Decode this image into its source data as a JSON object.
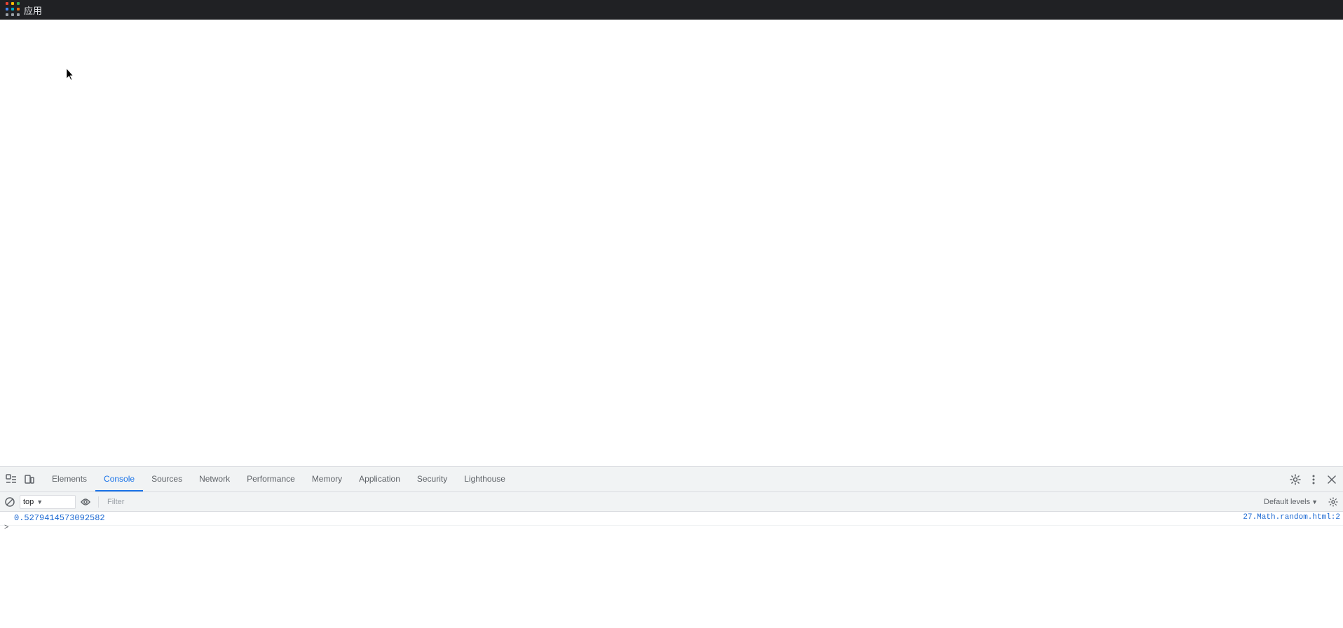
{
  "topbar": {
    "apps_label": "应用"
  },
  "devtools": {
    "tabs": [
      {
        "id": "elements",
        "label": "Elements",
        "active": false
      },
      {
        "id": "console",
        "label": "Console",
        "active": true
      },
      {
        "id": "sources",
        "label": "Sources",
        "active": false
      },
      {
        "id": "network",
        "label": "Network",
        "active": false
      },
      {
        "id": "performance",
        "label": "Performance",
        "active": false
      },
      {
        "id": "memory",
        "label": "Memory",
        "active": false
      },
      {
        "id": "application",
        "label": "Application",
        "active": false
      },
      {
        "id": "security",
        "label": "Security",
        "active": false
      },
      {
        "id": "lighthouse",
        "label": "Lighthouse",
        "active": false
      }
    ],
    "console": {
      "context": "top",
      "filter_placeholder": "Filter",
      "levels_label": "Default levels",
      "output": [
        {
          "value": "0.5279414573092582",
          "source": "27.Math.random.html:2"
        }
      ],
      "prompt_char": ">"
    }
  }
}
